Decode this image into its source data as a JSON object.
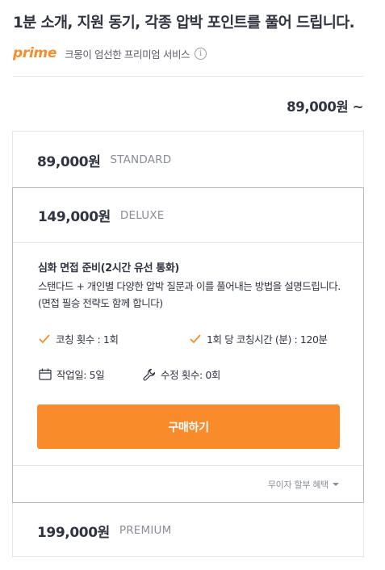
{
  "header": {
    "title": "1분 소개, 지원 동기, 각종 압박 포인트를 풀어 드립니다.",
    "prime_logo": "prime",
    "prime_desc": "크몽이 엄선한 프리미엄 서비스",
    "info_icon": "i"
  },
  "price_summary": {
    "from_price": "89,000원 ~"
  },
  "packages": [
    {
      "price": "89,000원",
      "name": "STANDARD"
    },
    {
      "price": "149,000원",
      "name": "DELUXE"
    },
    {
      "price": "199,000원",
      "name": "PREMIUM"
    }
  ],
  "deluxe": {
    "subtitle": "심화 면접 준비(2시간 유선 통화)",
    "description": "스탠다드 + 개인별 다양한 압박 질문과 이를 풀어내는 방법을 설명드립니다.(면접 필승 전략도 함께 합니다)",
    "features": [
      {
        "icon": "check-icon",
        "label": "코칭 횟수 : 1회"
      },
      {
        "icon": "check-icon",
        "label": "1회 당 코칭시간 (분) : 120분"
      },
      {
        "icon": "calendar-icon",
        "label": "작업일: 5일"
      },
      {
        "icon": "wrench-icon",
        "label": "수정 횟수: 0회"
      }
    ],
    "buy_label": "구매하기",
    "installment_label": "무이자 할부 혜택"
  },
  "colors": {
    "accent": "#f98b2a",
    "text": "#303441",
    "muted": "#8a8d96",
    "border": "#e4e5ed"
  }
}
